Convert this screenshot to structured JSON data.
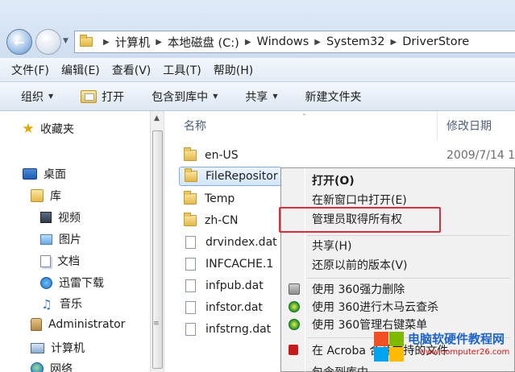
{
  "address_bar": {
    "crumbs": [
      "计算机",
      "本地磁盘 (C:)",
      "Windows",
      "System32",
      "DriverStore"
    ]
  },
  "menubar": {
    "items": [
      "文件(F)",
      "编辑(E)",
      "查看(V)",
      "工具(T)",
      "帮助(H)"
    ]
  },
  "toolbar": {
    "organize": "组织",
    "open": "打开",
    "include_in_library": "包含到库中",
    "share": "共享",
    "new_folder": "新建文件夹"
  },
  "navpane": {
    "favorites": "收藏夹",
    "desktop": "桌面",
    "libraries": "库",
    "videos": "视频",
    "pictures": "图片",
    "documents": "文档",
    "thunder_downloads": "迅雷下载",
    "music": "音乐",
    "administrator": "Administrator",
    "computer": "计算机",
    "network": "网络"
  },
  "filelist": {
    "col_name": "名称",
    "col_date": "修改日期",
    "rows": [
      {
        "name": "en-US",
        "type": "folder",
        "date": "2009/7/14 1"
      },
      {
        "name": "FileRepositor",
        "type": "folder",
        "date": ""
      },
      {
        "name": "Temp",
        "type": "folder",
        "date": ""
      },
      {
        "name": "zh-CN",
        "type": "folder",
        "date": ""
      },
      {
        "name": "drvindex.dat",
        "type": "file",
        "date": ""
      },
      {
        "name": "INFCACHE.1",
        "type": "file",
        "date": ""
      },
      {
        "name": "infpub.dat",
        "type": "file",
        "date": ""
      },
      {
        "name": "infstor.dat",
        "type": "file",
        "date": ""
      },
      {
        "name": "infstrng.dat",
        "type": "file",
        "date": ""
      }
    ]
  },
  "context_menu": {
    "open": "打开(O)",
    "open_new_window": "在新窗口中打开(E)",
    "take_ownership": "管理员取得所有权",
    "share": "共享(H)",
    "restore_previous": "还原以前的版本(V)",
    "del_360": "使用 360强力删除",
    "scan_360": "使用 360进行木马云查杀",
    "menu_360": "使用 360管理右键菜单",
    "acrobat": "在 Acroba    合并支持的文件",
    "include_lib": "包含到库中"
  },
  "colors": {
    "highlight": "#d8303a",
    "selection": "#d4e6fa",
    "watermark": "#1e64c8"
  },
  "watermark": {
    "title": "电脑软硬件教程网",
    "url": "www.computer26.com"
  }
}
